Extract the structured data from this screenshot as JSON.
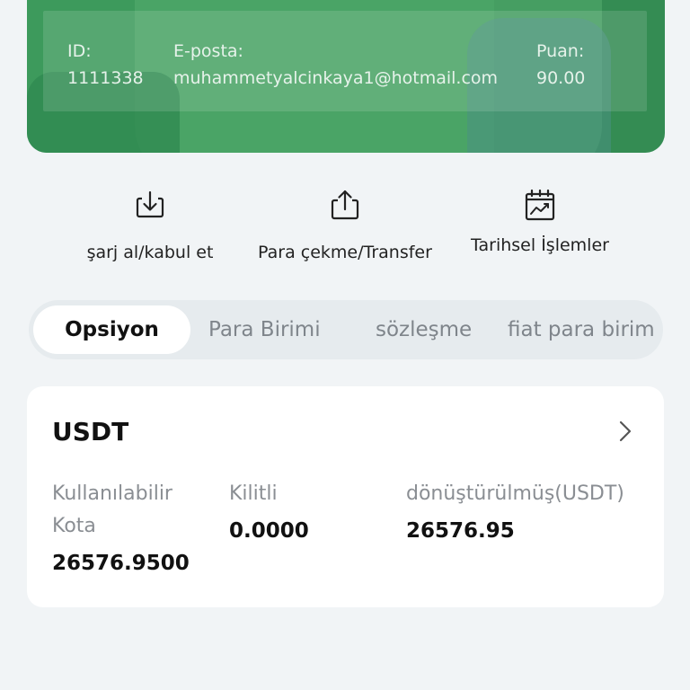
{
  "account": {
    "id_label": "ID:",
    "id_value": "1111338",
    "email_label": "E-posta:",
    "email_value": "muhammetyalcinkaya1@hotmail.com",
    "score_label": "Puan:",
    "score_value": "90.00"
  },
  "actions": [
    {
      "label": "şarj al/kabul et",
      "icon": "download-icon"
    },
    {
      "label": "Para çekme/Transfer",
      "icon": "upload-icon"
    },
    {
      "label": "Tarihsel İşlemler",
      "icon": "calendar-chart-icon"
    }
  ],
  "tabs": [
    {
      "label": "Opsiyon",
      "active": true
    },
    {
      "label": "Para Birimi"
    },
    {
      "label": "sözleşme"
    },
    {
      "label": "fiat para birim"
    }
  ],
  "balance": {
    "currency": "USDT",
    "available_label": "Kullanılabilir Kota",
    "available_value": "26576.9500",
    "locked_label": "Kilitli",
    "locked_value": "0.0000",
    "converted_label": "dönüştürülmüş(USDT)",
    "converted_value": "26576.95"
  },
  "colors": {
    "brand_green": "#3d9a5c",
    "background": "#f1f4f6"
  }
}
